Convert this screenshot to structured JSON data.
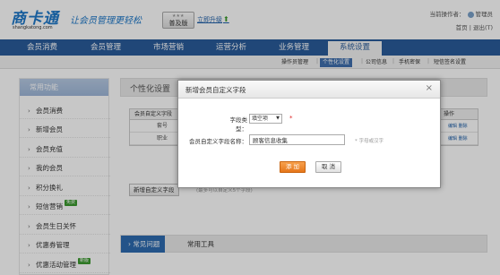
{
  "header": {
    "logo_text": "商卡通",
    "logo_domain": "shangkatong.com",
    "slogan": "让会员管理更轻松",
    "edition": "普及版",
    "upgrade_link": "立即升级",
    "operator_label": "当前操作者：",
    "operator_name": "管理员",
    "home_link": "首页",
    "logout_link": "退出(T)"
  },
  "nav": {
    "items": [
      {
        "label": "会员消费"
      },
      {
        "label": "会员管理"
      },
      {
        "label": "市场营销"
      },
      {
        "label": "运营分析"
      },
      {
        "label": "业务管理"
      },
      {
        "label": "系统设置"
      }
    ],
    "active": "系统设置"
  },
  "subnav": {
    "items": [
      {
        "label": "操作员管理"
      },
      {
        "label": "个性化设置"
      },
      {
        "label": "公司信息"
      },
      {
        "label": "手机密保"
      },
      {
        "label": "短信签名设置"
      }
    ],
    "active": "个性化设置"
  },
  "sidebar": {
    "title": "常用功能",
    "items": [
      {
        "label": "会员消费"
      },
      {
        "label": "新增会员"
      },
      {
        "label": "会员充值"
      },
      {
        "label": "我的会员"
      },
      {
        "label": "积分换礼"
      },
      {
        "label": "短信营销",
        "badge": "免费"
      },
      {
        "label": "会员生日关怀"
      },
      {
        "label": "优惠券管理"
      },
      {
        "label": "优惠活动管理",
        "badge": "新版"
      }
    ]
  },
  "main": {
    "title": "个性化设置",
    "table": {
      "col_field": "会员自定义字段",
      "col_op": "操作",
      "rows": [
        {
          "name": "套号",
          "op": "编辑 删除"
        },
        {
          "name": "职业",
          "op": "编辑 删除"
        }
      ]
    },
    "add_field_button": "新增自定义字段",
    "add_field_note": "(最多可以自定义5个字段)",
    "bottom_tabs": [
      {
        "label": "常见问题"
      },
      {
        "label": "常用工具"
      }
    ]
  },
  "modal": {
    "title": "新增会员自定义字段",
    "type_label": "字段类型：",
    "type_value": "填空项",
    "name_label": "会员自定义字段名称：",
    "name_value": "顾客信息收集",
    "name_hint": "* 字母或汉字",
    "add_button": "添 加",
    "cancel_button": "取 消"
  }
}
